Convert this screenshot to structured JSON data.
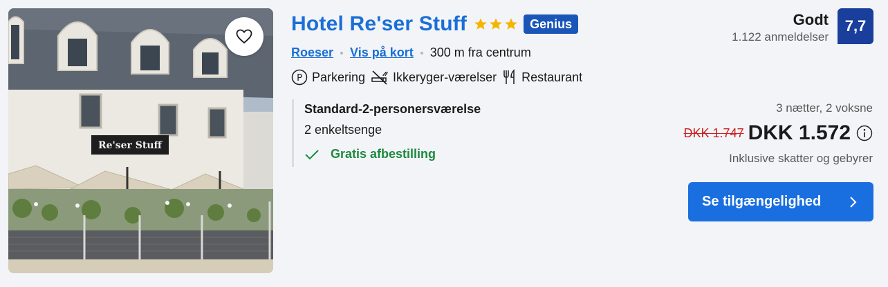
{
  "hotel": {
    "name": "Hotel Re'ser Stuff",
    "star_count": 3,
    "badge": "Genius",
    "sign_text": "Re'ser Stuff"
  },
  "location": {
    "city": "Roeser",
    "map_link": "Vis på kort",
    "distance": "300 m fra centrum"
  },
  "amenities": [
    {
      "icon": "parking-icon",
      "label": "Parkering"
    },
    {
      "icon": "no-smoking-icon",
      "label": "Ikkeryger-værelser"
    },
    {
      "icon": "restaurant-icon",
      "label": "Restaurant"
    }
  ],
  "room": {
    "name": "Standard-2-personersværelse",
    "beds": "2 enkeltsenge",
    "cancellation": "Gratis afbestilling"
  },
  "rating": {
    "word": "Godt",
    "reviews": "1.122 anmeldelser",
    "score": "7,7"
  },
  "price": {
    "stay": "3 nætter, 2 voksne",
    "original": "DKK 1.747",
    "current": "DKK 1.572",
    "taxes": "Inklusive skatter og gebyrer"
  },
  "cta": {
    "label": "Se tilgængelighed"
  },
  "colors": {
    "link": "#1a6fd6",
    "genius": "#1a56b8",
    "score_bg": "#1a3e9c",
    "cta": "#1a6fe0",
    "strike_price": "#cc1f1f",
    "cancellation": "#1b8a3e",
    "star": "#f5b400"
  }
}
